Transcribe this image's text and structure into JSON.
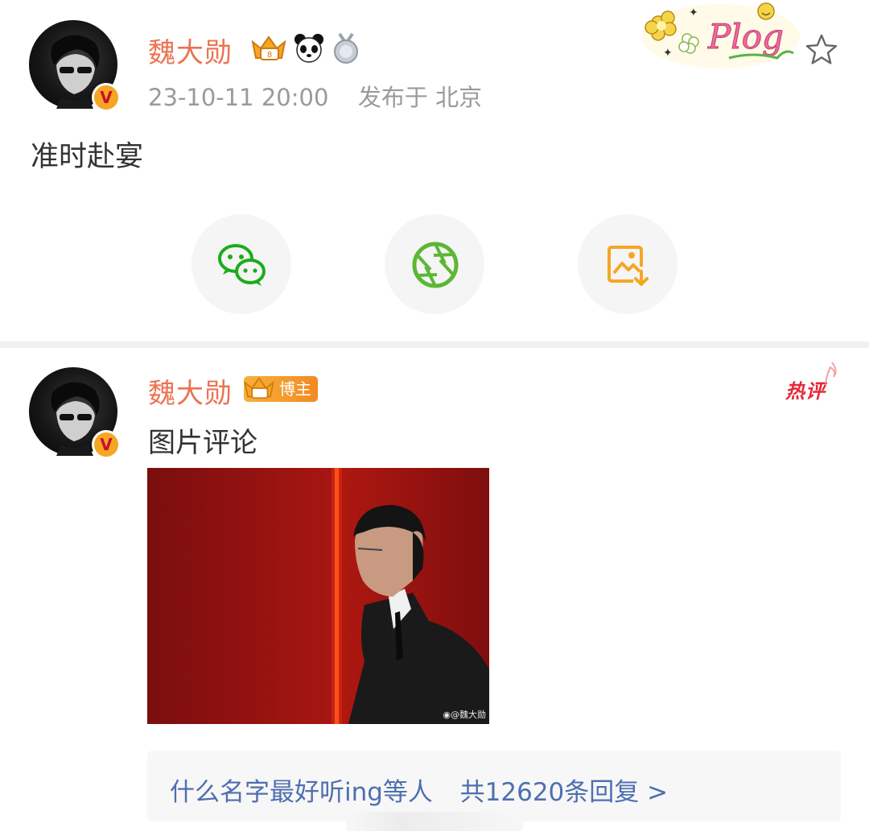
{
  "post": {
    "username": "魏大勋",
    "timestamp": "23-10-11 20:00",
    "location": "发布于 北京",
    "text": "准时赴宴",
    "vip_badges": [
      "crown-vip-icon",
      "panda-icon",
      "medal-icon"
    ],
    "decoration": "Plog"
  },
  "share": {
    "items": [
      {
        "name": "wechat",
        "icon": "wechat-icon",
        "color": "#1aad19"
      },
      {
        "name": "moments",
        "icon": "moments-icon",
        "color": "#5bb734"
      },
      {
        "name": "save-image",
        "icon": "save-image-icon",
        "color": "#f5a623"
      }
    ]
  },
  "comment": {
    "username": "魏大勋",
    "role_badge": "博主",
    "hot_tag": "热评",
    "text": "图片评论",
    "image_watermark": "@魏大勋",
    "replies": {
      "from": "什么名字最好听ing等人",
      "count_text": "共12620条回复 >"
    }
  },
  "colors": {
    "username": "#eb7350",
    "link": "#4e6fb0",
    "hot": "#e5283a"
  }
}
